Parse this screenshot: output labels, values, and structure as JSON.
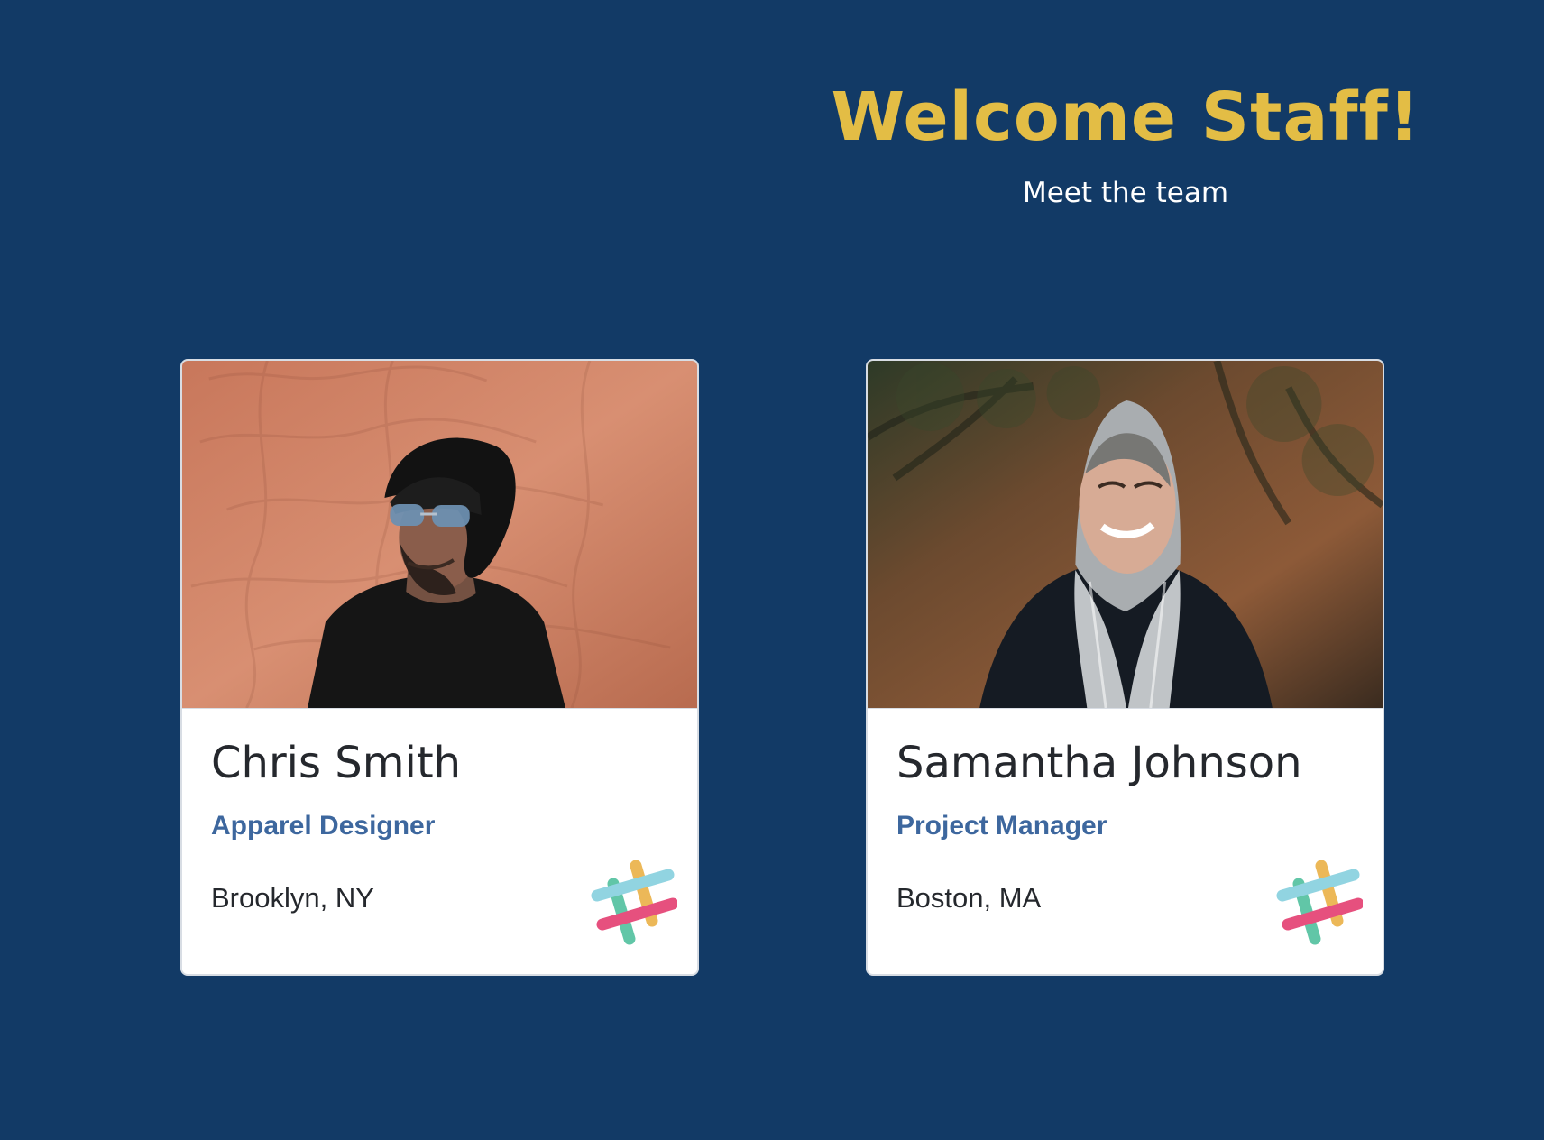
{
  "header": {
    "title": "Welcome Staff!",
    "subtitle": "Meet the team"
  },
  "team": [
    {
      "name": "Chris Smith",
      "role": "Apparel Designer",
      "location": "Brooklyn, NY",
      "photo_icon": "profile-photo",
      "contact_icon": "slack-icon"
    },
    {
      "name": "Samantha Johnson",
      "role": "Project Manager",
      "location": "Boston, MA",
      "photo_icon": "profile-photo",
      "contact_icon": "slack-icon"
    }
  ],
  "colors": {
    "background": "#123a66",
    "title": "#e3bd45",
    "subtitle": "#ffffff",
    "card_background": "#ffffff",
    "name": "#25282d",
    "role": "#3d679e"
  }
}
